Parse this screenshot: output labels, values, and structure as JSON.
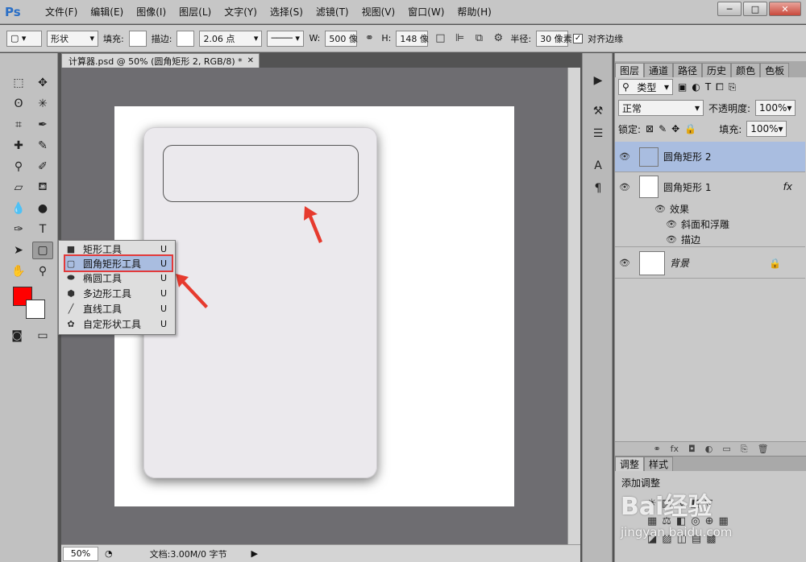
{
  "app": {
    "logo": "Ps"
  },
  "menu": [
    "文件(F)",
    "编辑(E)",
    "图像(I)",
    "图层(L)",
    "文字(Y)",
    "选择(S)",
    "滤镜(T)",
    "视图(V)",
    "窗口(W)",
    "帮助(H)"
  ],
  "window_controls": {
    "minimize": "─",
    "maximize": "□",
    "close": "✕"
  },
  "options": {
    "mode": "形状",
    "fill_label": "填充:",
    "stroke_label": "描边:",
    "stroke_width": "2.06 点",
    "w_label": "W:",
    "w_value": "500 像",
    "h_label": "H:",
    "h_value": "148 像",
    "radius_label": "半径:",
    "radius_value": "30 像素",
    "align_edges": "对齐边缘"
  },
  "document": {
    "tab_title": "计算器.psd @ 50% (圆角矩形 2, RGB/8) *",
    "zoom": "50%",
    "info": "文档:3.00M/0 字节"
  },
  "flyout": [
    {
      "label": "矩形工具",
      "key": "U",
      "icon": "rectangle-icon"
    },
    {
      "label": "圆角矩形工具",
      "key": "U",
      "icon": "rounded-rectangle-icon",
      "selected": true
    },
    {
      "label": "椭圆工具",
      "key": "U",
      "icon": "ellipse-icon"
    },
    {
      "label": "多边形工具",
      "key": "U",
      "icon": "polygon-icon"
    },
    {
      "label": "直线工具",
      "key": "U",
      "icon": "line-icon"
    },
    {
      "label": "自定形状工具",
      "key": "U",
      "icon": "custom-shape-icon"
    }
  ],
  "layers_panel": {
    "tabs": [
      "图层",
      "通道",
      "路径",
      "历史",
      "颜色",
      "色板"
    ],
    "filter": "类型",
    "blend_mode": "正常",
    "opacity_label": "不透明度:",
    "opacity_value": "100%",
    "lock_label": "锁定:",
    "fill_label": "填充:",
    "fill_value": "100%",
    "layers": [
      {
        "name": "圆角矩形 2",
        "selected": true
      },
      {
        "name": "圆角矩形 1",
        "fx": "fx"
      },
      {
        "name": "效果"
      },
      {
        "name": "斜面和浮雕"
      },
      {
        "name": "描边"
      },
      {
        "name": "背景"
      }
    ]
  },
  "adjust_panel": {
    "tabs": [
      "调整",
      "样式"
    ],
    "title": "添加调整"
  },
  "watermark": {
    "brand": "Bai经验",
    "url": "jingyan.baidu.com"
  },
  "colors": {
    "foreground": "#ff0000",
    "background": "#ffffff",
    "selection": "#a9bde0",
    "highlight_border": "#e23a3a"
  }
}
